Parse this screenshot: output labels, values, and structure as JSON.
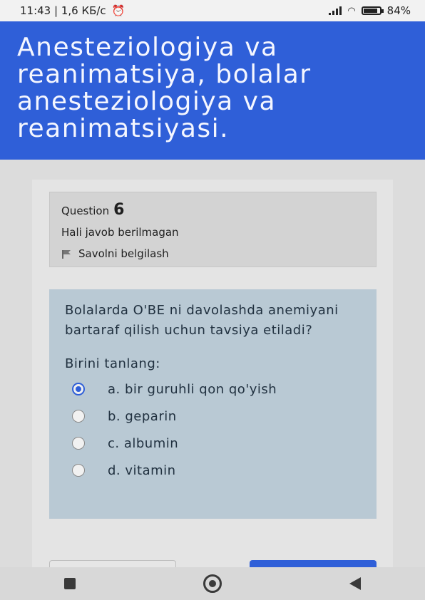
{
  "status_bar": {
    "left_text": "11:43 | 1,6 КБ/с",
    "battery": "84%",
    "battery_level": 0.84
  },
  "header": {
    "title_lines": [
      "Anesteziologiya va",
      "reanimatsiya, bolalar",
      "anesteziologiya va",
      "reanimatsiyasi."
    ]
  },
  "question": {
    "label": "Question",
    "number": "6",
    "state": "Hali javob berilmagan",
    "flag_label": "Savolni belgilash",
    "text": "Bolalarda O'BE ni davolashda anemiyani bartaraf qilish uchun tavsiya etiladi?",
    "prompt": "Birini tanlang:",
    "answers": [
      {
        "label": "a. bir guruhli qon qo'yish",
        "selected": true
      },
      {
        "label": "b. geparin",
        "selected": false
      },
      {
        "label": "c. albumin",
        "selected": false
      },
      {
        "label": "d. vitamin",
        "selected": false
      }
    ]
  },
  "colors": {
    "accent": "#2f5fd8",
    "content_bg": "#b9c9d4"
  },
  "icons": [
    "alarm-clock-icon",
    "signal-icon",
    "wifi-icon",
    "battery-icon",
    "flag-icon",
    "recents-icon",
    "home-icon",
    "back-icon"
  ]
}
